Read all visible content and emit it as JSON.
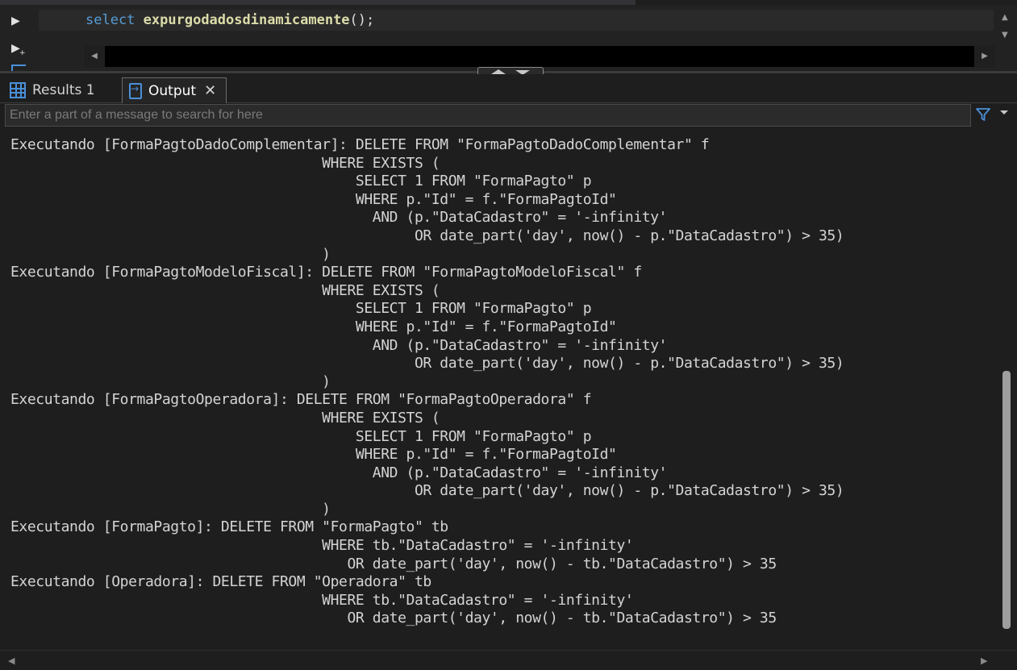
{
  "editor": {
    "code": {
      "keyword": "select",
      "function": "expurgodadosdinamicamente",
      "punctuation": "();"
    },
    "icons": {
      "run": "play-icon",
      "run_new": "play-plus-icon"
    }
  },
  "tabs": [
    {
      "label": "Results 1",
      "icon": "grid-icon",
      "active": false
    },
    {
      "label": "Output",
      "icon": "output-icon",
      "active": true,
      "closable": true
    }
  ],
  "search": {
    "placeholder": "Enter a part of a message to search for here",
    "value": ""
  },
  "output_lines": [
    "Executando [FormaPagtoDadoComplementar]: DELETE FROM \"FormaPagtoDadoComplementar\" f",
    "                                     WHERE EXISTS (",
    "                                         SELECT 1 FROM \"FormaPagto\" p",
    "                                         WHERE p.\"Id\" = f.\"FormaPagtoId\"",
    "                                           AND (p.\"DataCadastro\" = '-infinity'",
    "                                                OR date_part('day', now() - p.\"DataCadastro\") > 35)",
    "                                     )",
    "Executando [FormaPagtoModeloFiscal]: DELETE FROM \"FormaPagtoModeloFiscal\" f",
    "                                     WHERE EXISTS (",
    "                                         SELECT 1 FROM \"FormaPagto\" p",
    "                                         WHERE p.\"Id\" = f.\"FormaPagtoId\"",
    "                                           AND (p.\"DataCadastro\" = '-infinity'",
    "                                                OR date_part('day', now() - p.\"DataCadastro\") > 35)",
    "                                     )",
    "Executando [FormaPagtoOperadora]: DELETE FROM \"FormaPagtoOperadora\" f",
    "                                     WHERE EXISTS (",
    "                                         SELECT 1 FROM \"FormaPagto\" p",
    "                                         WHERE p.\"Id\" = f.\"FormaPagtoId\"",
    "                                           AND (p.\"DataCadastro\" = '-infinity'",
    "                                                OR date_part('day', now() - p.\"DataCadastro\") > 35)",
    "                                     )",
    "Executando [FormaPagto]: DELETE FROM \"FormaPagto\" tb",
    "                                     WHERE tb.\"DataCadastro\" = '-infinity'",
    "                                        OR date_part('day', now() - tb.\"DataCadastro\") > 35",
    "Executando [Operadora]: DELETE FROM \"Operadora\" tb",
    "                                     WHERE tb.\"DataCadastro\" = '-infinity'",
    "                                        OR date_part('day', now() - tb.\"DataCadastro\") > 35"
  ],
  "colors": {
    "keyword": "#569cd6",
    "function": "#dcdcaa",
    "accent": "#4a90d9"
  }
}
